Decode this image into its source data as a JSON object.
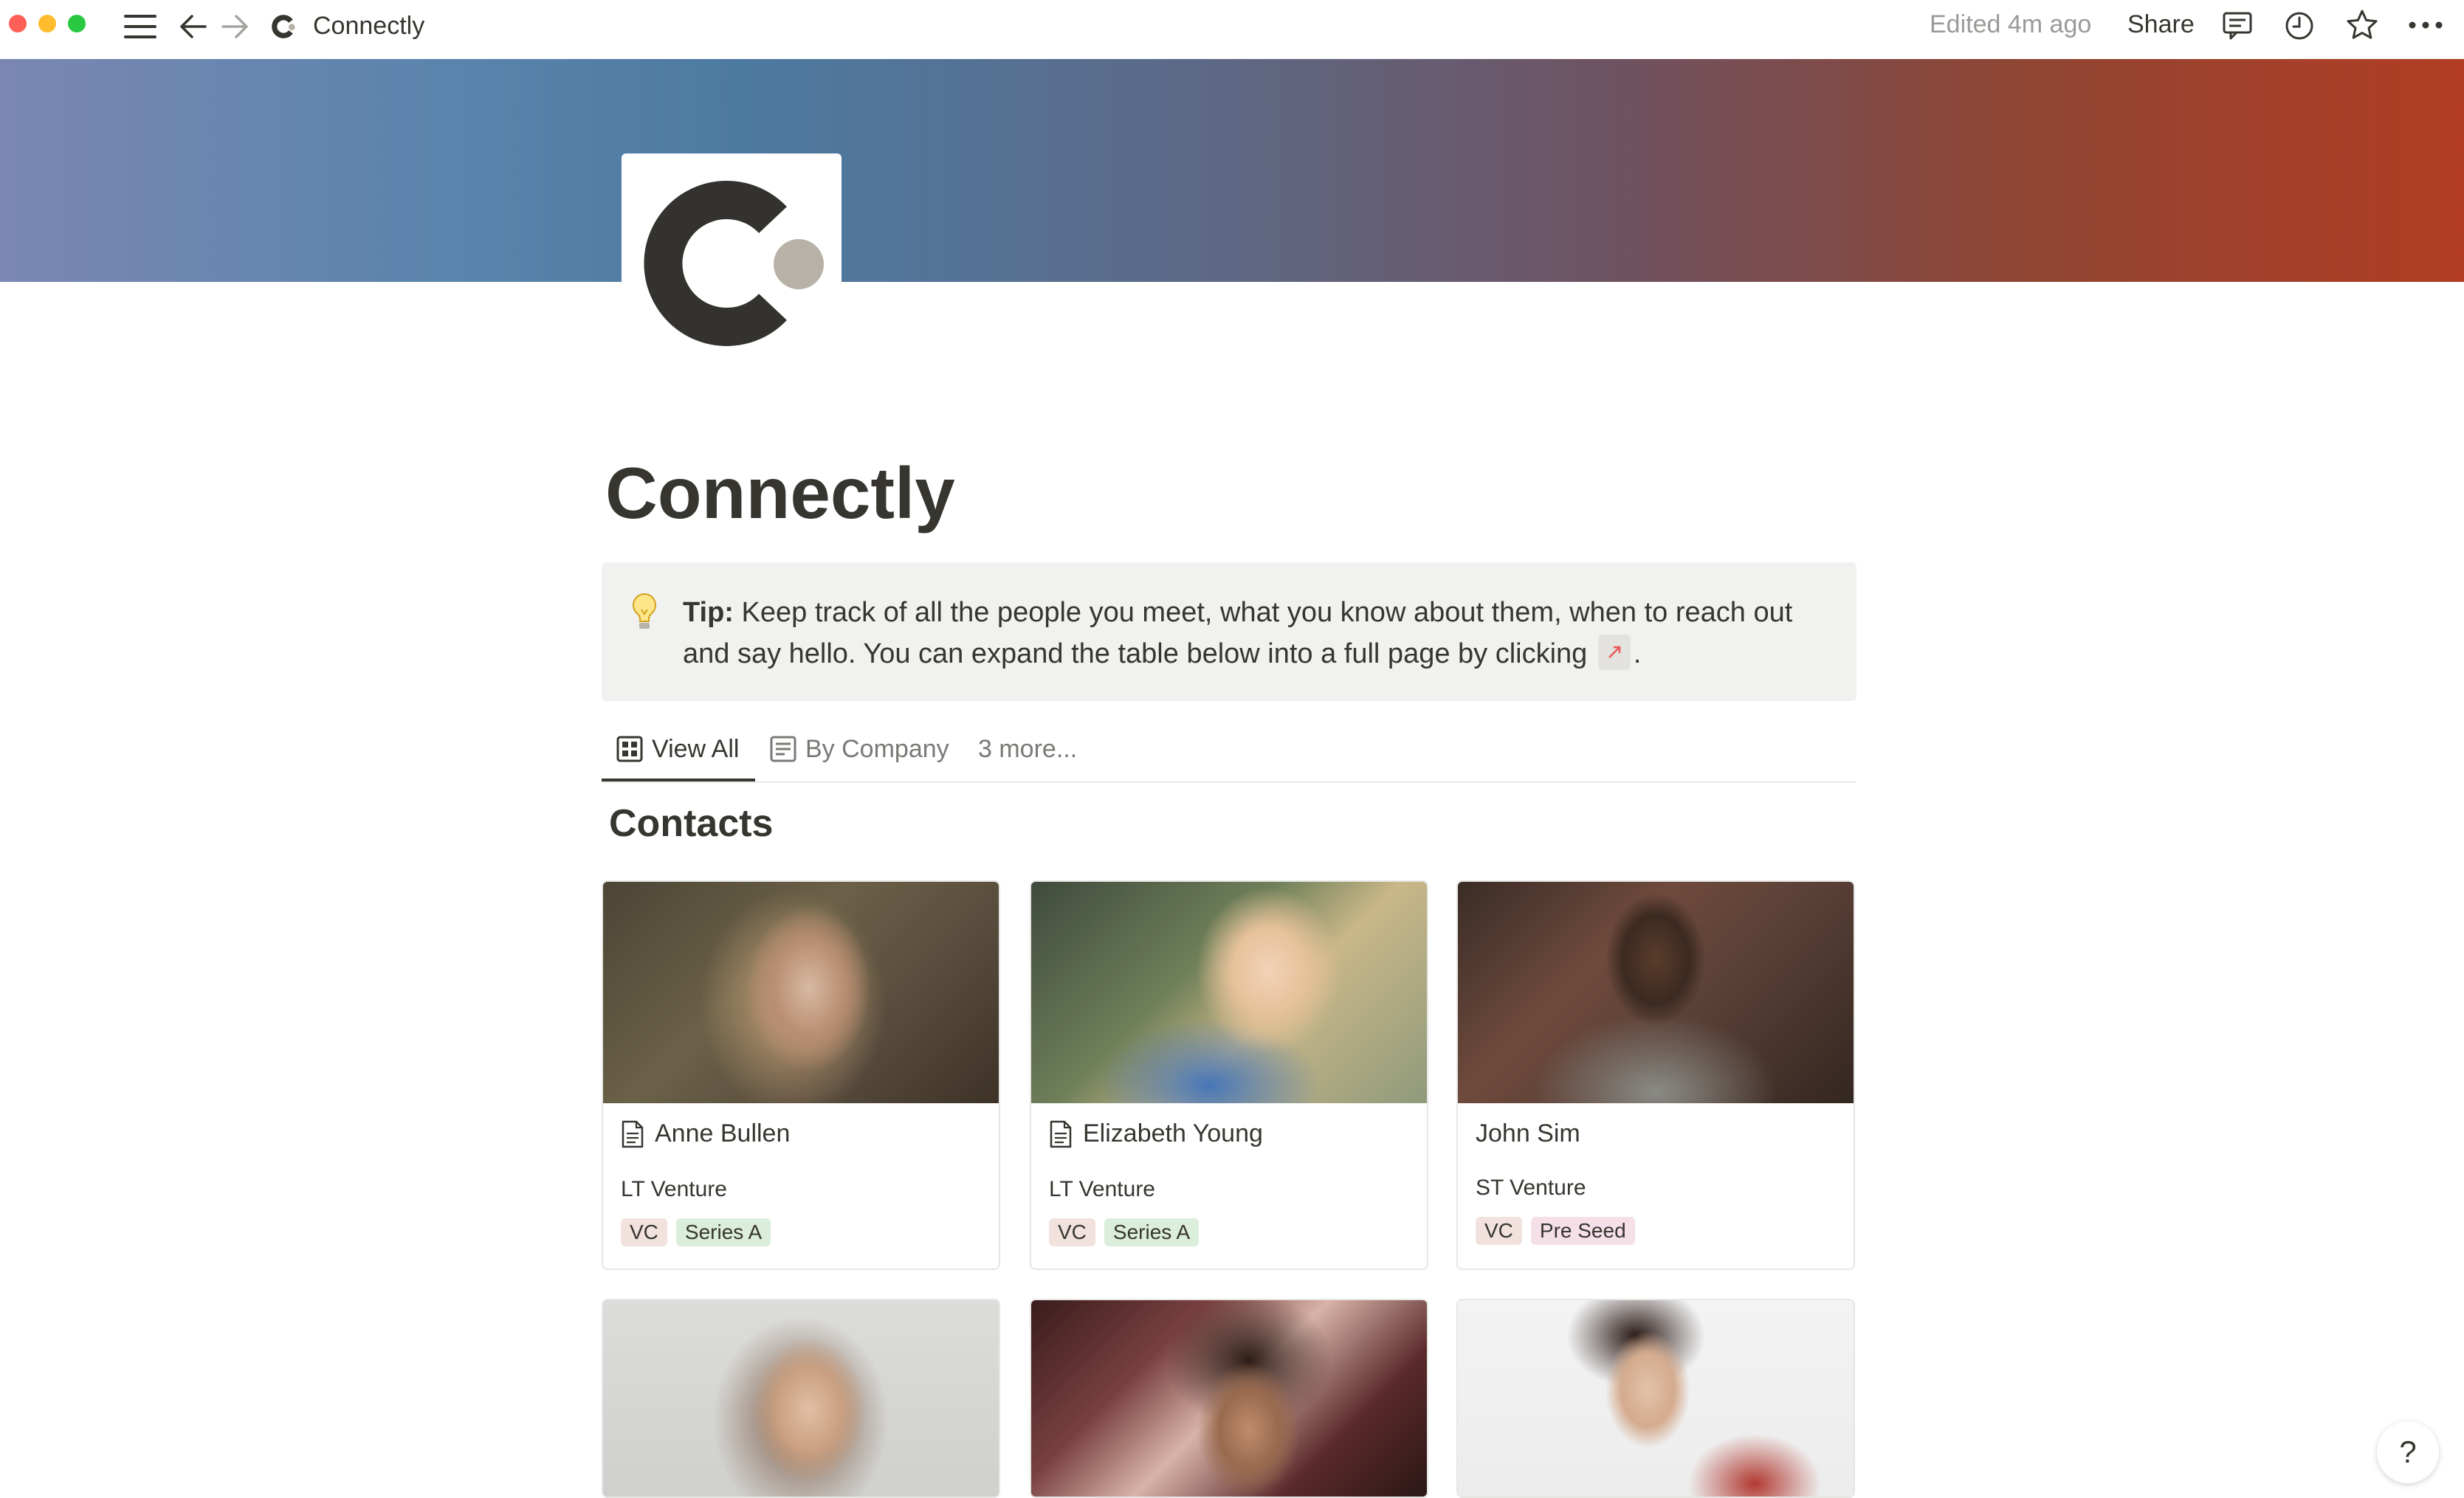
{
  "window": {
    "title": "Connectly",
    "edited": "Edited 4m ago",
    "share_label": "Share"
  },
  "page": {
    "title": "Connectly",
    "icon": "connectly-logo"
  },
  "callout": {
    "icon": "lightbulb-icon",
    "tip_label": "Tip:",
    "text_part1": "Keep track of all the people you meet, what you know about them, when to reach out and say hello. You can expand the table below into a full page by clicking",
    "text_end": "."
  },
  "tabs": [
    {
      "label": "View All",
      "icon": "gallery-icon",
      "active": true
    },
    {
      "label": "By Company",
      "icon": "board-icon",
      "active": false
    },
    {
      "label": "3 more...",
      "active": false
    }
  ],
  "section_title": "Contacts",
  "contacts": [
    {
      "name": "Anne Bullen",
      "company": "LT Venture",
      "tags": [
        "VC",
        "Series A"
      ],
      "has_doc_icon": true
    },
    {
      "name": "Elizabeth Young",
      "company": "LT Venture",
      "tags": [
        "VC",
        "Series A"
      ],
      "has_doc_icon": true
    },
    {
      "name": "John Sim",
      "company": "ST Venture",
      "tags": [
        "VC",
        "Pre Seed"
      ],
      "has_doc_icon": false
    },
    {
      "name": "",
      "company": "",
      "tags": []
    },
    {
      "name": "",
      "company": "",
      "tags": []
    },
    {
      "name": "",
      "company": "",
      "tags": []
    }
  ],
  "help_label": "?",
  "colors": {
    "text": "#37352f",
    "callout_bg": "#f1f1ef",
    "tag_vc": "#f1e2de",
    "tag_series_a": "#dbeddb",
    "tag_pre_seed": "#f5e0e9",
    "cover_left": "#7a87b2",
    "cover_right": "#b23d24"
  }
}
